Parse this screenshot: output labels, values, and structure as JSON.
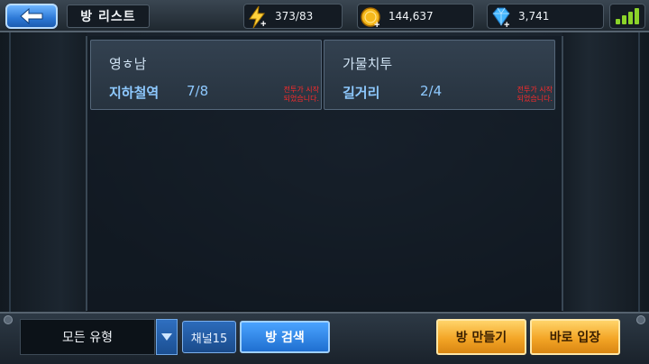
{
  "header": {
    "title": "방 리스트",
    "energy": "373/83",
    "gold": "144,637",
    "gems": "3,741"
  },
  "rooms": [
    {
      "name": "영ㅎ남",
      "map": "지하철역",
      "players": "7/8",
      "status_line1": "전투가 시작",
      "status_line2": "되었습니다."
    },
    {
      "name": "가물치투",
      "map": "길거리",
      "players": "2/4",
      "status_line1": "전투가 시작",
      "status_line2": "되었습니다."
    }
  ],
  "footer": {
    "filter_value": "모든 유형",
    "channel_label": "채널15",
    "search_label": "방 검색",
    "create_label": "방 만들기",
    "quick_join_label": "바로 입장"
  },
  "colors": {
    "accent_blue": "#2c78d6",
    "accent_orange": "#f3a526",
    "status_red": "#ff2a2a",
    "signal_green": "#8bd32a"
  },
  "icons": [
    "back-arrow-icon",
    "energy-icon",
    "gold-coin-icon",
    "gem-icon",
    "signal-icon",
    "dropdown-arrow-icon"
  ]
}
